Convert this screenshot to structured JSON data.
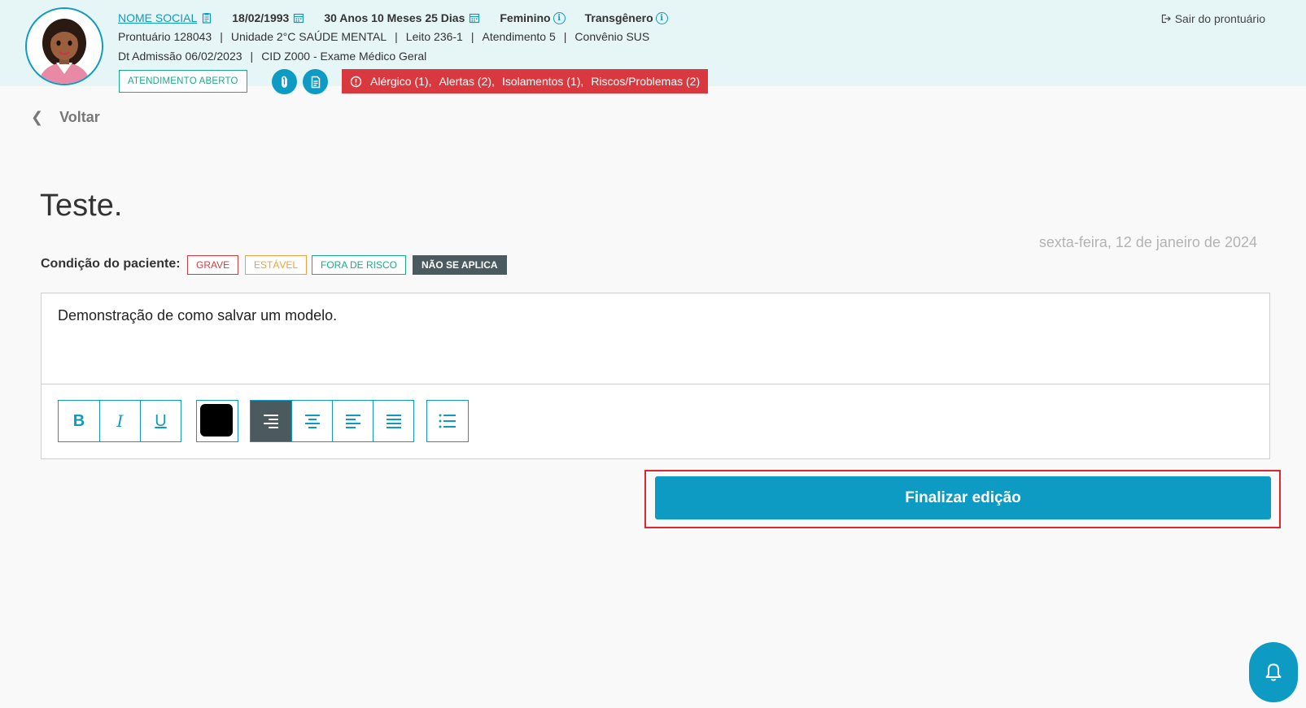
{
  "patient": {
    "social_name": "NOME SOCIAL",
    "birth_date": "18/02/1993",
    "age": "30 Anos 10 Meses 25 Dias",
    "gender": "Feminino",
    "identity": "Transgênero",
    "prontuario": "Prontuário 128043",
    "unidade": "Unidade 2°C SAÚDE MENTAL",
    "leito": "Leito 236-1",
    "atendimento": "Atendimento 5",
    "convenio": "Convênio SUS",
    "admissao": "Dt Admissão 06/02/2023",
    "cid": "CID Z000 - Exame Médico Geral",
    "status_badge": "ATENDIMENTO ABERTO",
    "separator": "|"
  },
  "alerts": [
    "Alérgico (1),",
    "Alertas (2),",
    "Isolamentos (1),",
    "Riscos/Problemas (2)"
  ],
  "header": {
    "exit_label": "Sair do prontuário"
  },
  "nav": {
    "back_label": "Voltar"
  },
  "note": {
    "title": "Teste.",
    "date": "sexta-feira, 12 de janeiro de 2024",
    "condition_label": "Condição do paciente:",
    "conditions": {
      "grave": "GRAVE",
      "estavel": "ESTÁVEL",
      "fora": "FORA DE RISCO",
      "na": "NÃO SE APLICA"
    },
    "selected_condition": "NÃO SE APLICA",
    "body_text": "Demonstração de como salvar um modelo."
  },
  "toolbar": {
    "bold": "B",
    "italic": "I",
    "underline": "U",
    "text_color": "#000000",
    "active_alignment": "right"
  },
  "actions": {
    "finish_label": "Finalizar edição"
  },
  "colors": {
    "primary": "#0d9bc4",
    "alert": "#d9393e",
    "success": "#1aaa8a",
    "warning": "#f0a040",
    "dark": "#4a5a5f"
  }
}
